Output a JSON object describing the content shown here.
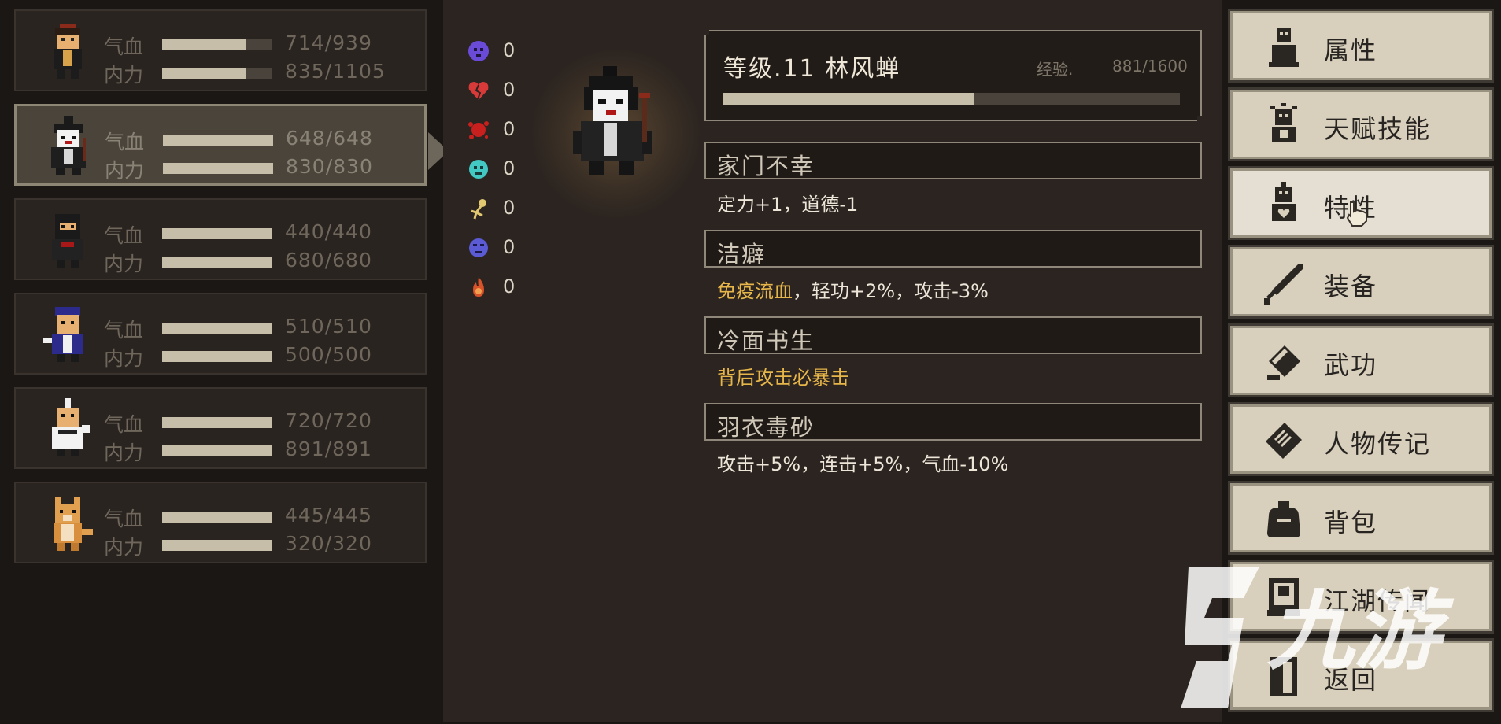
{
  "roster": [
    {
      "hp_label": "气血",
      "mp_label": "内力",
      "hp": "714/939",
      "mp": "835/1105",
      "hp_frac": 0.76,
      "mp_frac": 0.76
    },
    {
      "hp_label": "气血",
      "mp_label": "内力",
      "hp": "648/648",
      "mp": "830/830",
      "hp_frac": 1.0,
      "mp_frac": 1.0
    },
    {
      "hp_label": "气血",
      "mp_label": "内力",
      "hp": "440/440",
      "mp": "680/680",
      "hp_frac": 1.0,
      "mp_frac": 1.0
    },
    {
      "hp_label": "气血",
      "mp_label": "内力",
      "hp": "510/510",
      "mp": "500/500",
      "hp_frac": 1.0,
      "mp_frac": 1.0
    },
    {
      "hp_label": "气血",
      "mp_label": "内力",
      "hp": "720/720",
      "mp": "891/891",
      "hp_frac": 1.0,
      "mp_frac": 1.0
    },
    {
      "hp_label": "气血",
      "mp_label": "内力",
      "hp": "445/445",
      "mp": "320/320",
      "hp_frac": 1.0,
      "mp_frac": 1.0
    }
  ],
  "resistances": [
    {
      "icon": "skull-poison-icon",
      "value": "0",
      "color": "#6a4bd8"
    },
    {
      "icon": "broken-heart-icon",
      "value": "0",
      "color": "#d83a3a"
    },
    {
      "icon": "blood-splat-icon",
      "value": "0",
      "color": "#c8201e"
    },
    {
      "icon": "teal-face-icon",
      "value": "0",
      "color": "#43c9c4"
    },
    {
      "icon": "stun-star-icon",
      "value": "0",
      "color": "#e2c870"
    },
    {
      "icon": "purple-face-icon",
      "value": "0",
      "color": "#5b5bd6"
    },
    {
      "icon": "fire-icon",
      "value": "0",
      "color": "#d8522a"
    }
  ],
  "character": {
    "level_title": "等级.11  林风蝉",
    "exp_label": "经验.",
    "exp_value": "881/1600",
    "exp_frac": 0.55
  },
  "traits": [
    {
      "name": "家门不幸",
      "desc_plain": "定力+1，道德-1",
      "desc_hl": ""
    },
    {
      "name": "洁癖",
      "desc_hl": "免疫流血",
      "desc_plain": "，轻功+2%，攻击-3%"
    },
    {
      "name": "冷面书生",
      "desc_hl": "背后攻击必暴击",
      "desc_plain": ""
    },
    {
      "name": "羽衣毒砂",
      "desc_plain": "攻击+5%，连击+5%，气血-10%",
      "desc_hl": ""
    }
  ],
  "menu": [
    {
      "label": "属性",
      "icon": "person-icon"
    },
    {
      "label": "天赋技能",
      "icon": "idea-person-icon"
    },
    {
      "label": "特性",
      "icon": "heart-person-icon"
    },
    {
      "label": "装备",
      "icon": "sword-icon"
    },
    {
      "label": "武功",
      "icon": "book-icon"
    },
    {
      "label": "人物传记",
      "icon": "scroll-icon"
    },
    {
      "label": "背包",
      "icon": "bag-icon"
    },
    {
      "label": "江湖传闻",
      "icon": "notice-board-icon"
    },
    {
      "label": "返回",
      "icon": "door-icon"
    }
  ],
  "watermark": {
    "text": "九游"
  },
  "colors": {
    "accent_text": "#e7b64a",
    "bar_fill": "#c6bea8"
  }
}
